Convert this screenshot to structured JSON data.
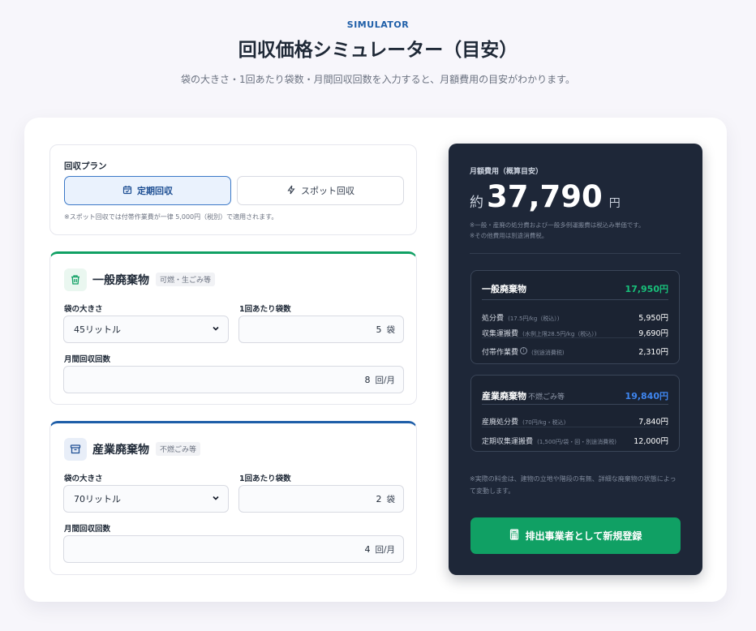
{
  "header": {
    "eyebrow": "SIMULATOR",
    "title": "回収価格シミュレーター（目安）",
    "subtitle": "袋の大きさ・1回あたり袋数・月間回収回数を入力すると、月額費用の目安がわかります。"
  },
  "plan": {
    "label": "回収プラン",
    "options": [
      {
        "label": "定期回収",
        "icon": "calendar-icon",
        "selected": true
      },
      {
        "label": "スポット回収",
        "icon": "lightning-icon",
        "selected": false
      }
    ],
    "note": "※スポット回収では付帯作業費が一律 5,000円（税別）で適用されます。"
  },
  "general": {
    "title": "一般廃棄物",
    "tag": "可燃・生ごみ等",
    "bag_size_label": "袋の大きさ",
    "bag_size_value": "45リットル",
    "bags_label": "1回あたり袋数",
    "bags_value": "5",
    "bags_unit": "袋",
    "monthly_label": "月間回収回数",
    "monthly_value": "8",
    "monthly_unit": "回/月"
  },
  "industrial": {
    "title": "産業廃棄物",
    "tag": "不燃ごみ等",
    "bag_size_label": "袋の大きさ",
    "bag_size_value": "70リットル",
    "bags_label": "1回あたり袋数",
    "bags_value": "2",
    "bags_unit": "袋",
    "monthly_label": "月間回収回数",
    "monthly_value": "4",
    "monthly_unit": "回/月"
  },
  "summary": {
    "label": "月額費用（概算目安）",
    "prefix": "約",
    "amount": "37,790",
    "yen": "円",
    "note_1": "※一般・産廃の処分費および一般多例運搬費は税込み単価です。",
    "note_2": "※その他費用は別途消費税。",
    "general": {
      "name": "一般廃棄物",
      "total": "17,950円",
      "rows": [
        {
          "label": "処分費",
          "hint": "(17.5円/kg（税込）)",
          "value": "5,950円"
        },
        {
          "label": "収集運搬費",
          "hint": "(水例上限28.5円/kg（税込）)",
          "value": "9,690円"
        },
        {
          "label": "付帯作業費",
          "hint": "(別途消費税)",
          "value": "2,310円"
        }
      ]
    },
    "industrial": {
      "name": "産業廃棄物",
      "sub": "不燃ごみ等",
      "total": "19,840円",
      "rows": [
        {
          "label": "産廃処分費",
          "hint": "(70円/kg・税込)",
          "value": "7,840円"
        },
        {
          "label": "定期収集運搬費",
          "hint": "(1,500円/袋・回・別途消費税)",
          "value": "12,000円"
        }
      ]
    },
    "footnote": "※実際の料金は、建物の立地や階段の有無、詳細な廃棄物の状態によって変動します。",
    "register_label": "排出事業者として新規登録"
  },
  "colors": {
    "green": "#10a064",
    "blue": "#1e5ea8",
    "summary_bg": "#1e2738"
  }
}
